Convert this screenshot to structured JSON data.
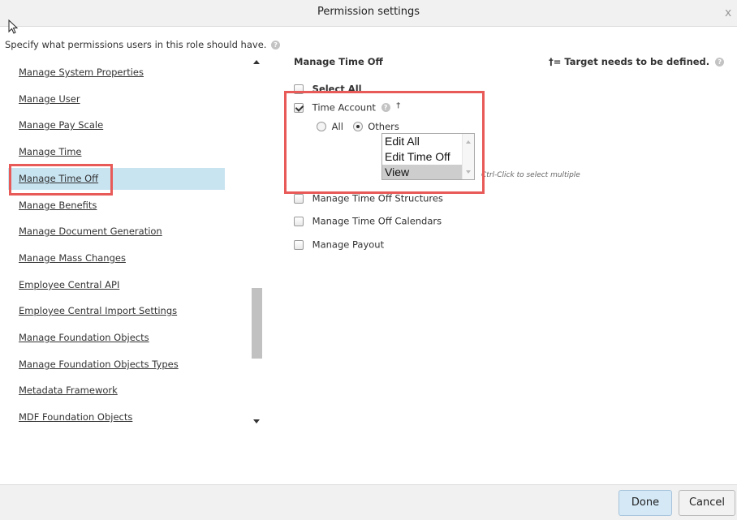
{
  "dialog": {
    "title": "Permission settings",
    "close_label": "x",
    "intro": "Specify what permissions users in this role should have.",
    "help_glyph": "?"
  },
  "left_list": {
    "items": [
      "Manage System Properties",
      "Manage User",
      "Manage Pay Scale",
      "Manage Time",
      "Manage Time Off",
      "Manage Benefits",
      "Manage Document Generation",
      "Manage Mass Changes",
      "Employee Central API",
      "Employee Central Import Settings",
      "Manage Foundation Objects",
      "Manage Foundation Objects Types",
      "Metadata Framework",
      "MDF Foundation Objects"
    ],
    "selected": "Manage Time Off"
  },
  "right_panel": {
    "section_title": "Manage Time Off",
    "target_note": "†= Target needs to be defined.",
    "select_all": "Select All",
    "time_account": "Time Account",
    "dagger": "†",
    "radio_all": "All",
    "radio_others": "Others",
    "options": [
      "Edit All",
      "Edit Time Off",
      "View"
    ],
    "selected_option": "View",
    "hint": "Ctrl-Click to select multiple",
    "checkboxes": [
      {
        "label": "Manage Time Off Structures",
        "checked": false
      },
      {
        "label": "Manage Time Off Calendars",
        "checked": false
      },
      {
        "label": "Manage Payout",
        "checked": false
      }
    ]
  },
  "footer": {
    "done_label": "Done",
    "cancel_label": "Cancel"
  },
  "colors": {
    "highlight": "#e85a58",
    "selected_row": "#c9e4f1",
    "done_button": "#d4e8f6"
  }
}
